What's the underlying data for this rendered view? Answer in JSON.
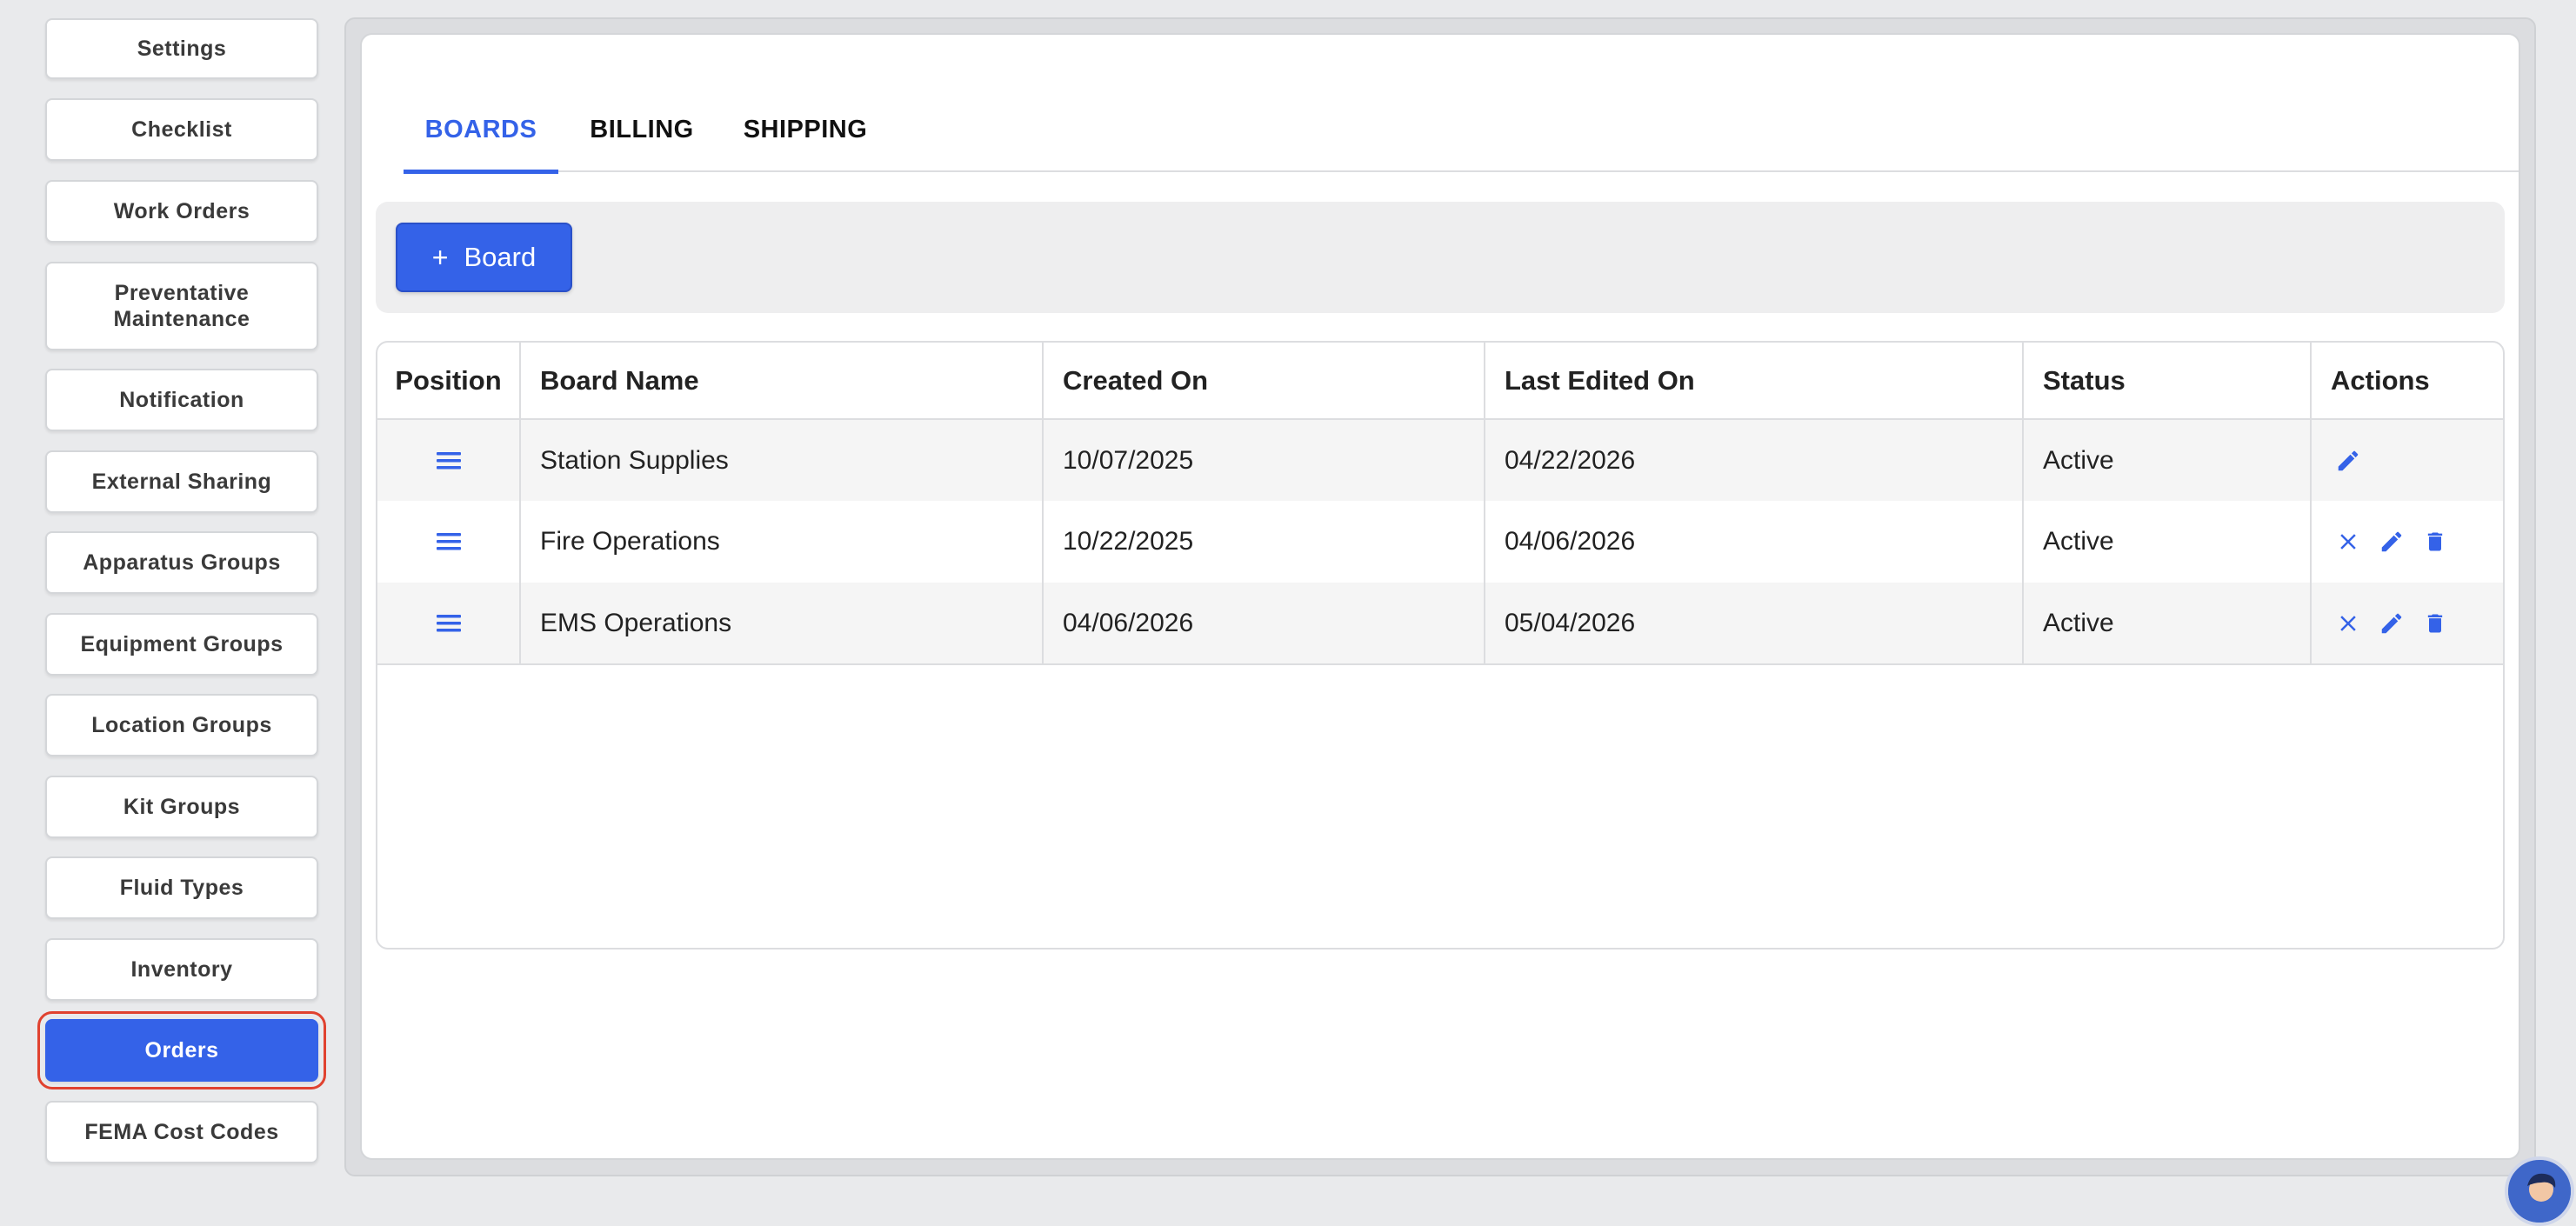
{
  "sidebar": {
    "items": [
      {
        "label": "Settings"
      },
      {
        "label": "Checklist"
      },
      {
        "label": "Work Orders"
      },
      {
        "label": "Preventative Maintenance"
      },
      {
        "label": "Notification"
      },
      {
        "label": "External Sharing"
      },
      {
        "label": "Apparatus Groups"
      },
      {
        "label": "Equipment Groups"
      },
      {
        "label": "Location Groups"
      },
      {
        "label": "Kit Groups"
      },
      {
        "label": "Fluid Types"
      },
      {
        "label": "Inventory"
      },
      {
        "label": "Orders",
        "active": true
      },
      {
        "label": "FEMA Cost Codes"
      }
    ]
  },
  "tabs": [
    {
      "label": "BOARDS",
      "active": true
    },
    {
      "label": "BILLING"
    },
    {
      "label": "SHIPPING"
    }
  ],
  "toolbar": {
    "add_board_label": "Board",
    "add_icon": "plus-icon"
  },
  "table": {
    "headers": [
      "Position",
      "Board Name",
      "Created On",
      "Last Edited On",
      "Status",
      "Actions"
    ],
    "rows": [
      {
        "name": "Station Supplies",
        "created": "10/07/2025",
        "edited": "04/22/2026",
        "status": "Active",
        "actions": [
          "edit"
        ]
      },
      {
        "name": "Fire Operations",
        "created": "10/22/2025",
        "edited": "04/06/2026",
        "status": "Active",
        "actions": [
          "close",
          "edit",
          "delete"
        ]
      },
      {
        "name": "EMS Operations",
        "created": "04/06/2026",
        "edited": "05/04/2026",
        "status": "Active",
        "actions": [
          "close",
          "edit",
          "delete"
        ]
      }
    ]
  },
  "colors": {
    "accent": "#3462e8",
    "active_outline": "#e0422f",
    "background": "#e9eaec"
  }
}
